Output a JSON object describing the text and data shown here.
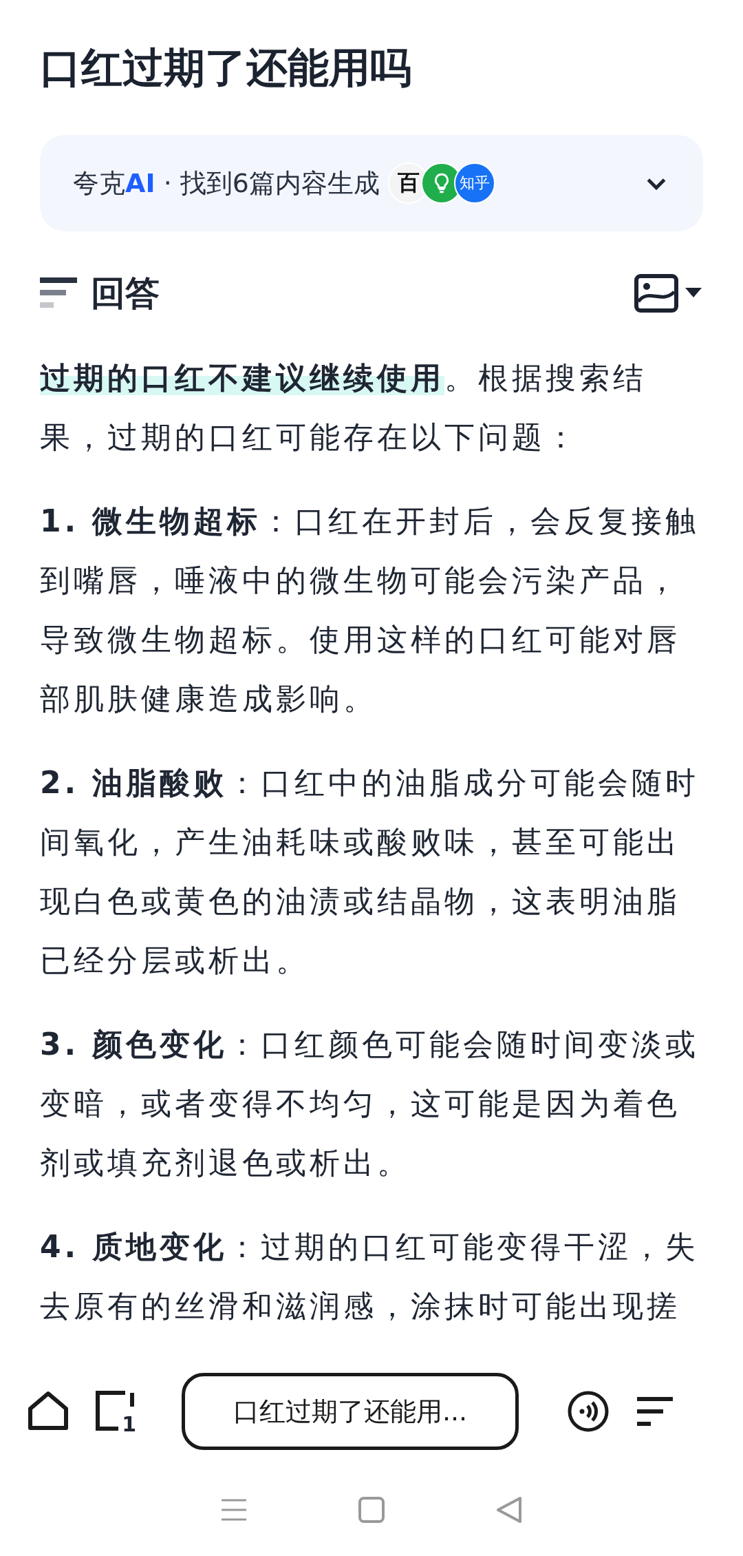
{
  "title": "口红过期了还能用吗",
  "source_card": {
    "brand": "夸克",
    "brand_ai": "AI",
    "summary": "· 找到6篇内容生成",
    "sources": [
      {
        "kind": "baike",
        "label": "百"
      },
      {
        "kind": "bulb"
      },
      {
        "kind": "zhihu",
        "label": "知乎"
      }
    ],
    "expanded": false
  },
  "answer": {
    "heading": "回答",
    "lead_highlight": "过期的口红不建议继续使用",
    "lead_rest": "。根据搜索结果，过期的口红可能存在以下问题：",
    "items": [
      {
        "number": "1.",
        "title": "微生物超标",
        "body": "：口红在开封后，会反复接触到嘴唇，唾液中的微生物可能会污染产品，导致微生物超标。使用这样的口红可能对唇部肌肤健康造成影响。"
      },
      {
        "number": "2.",
        "title": "油脂酸败",
        "body": "：口红中的油脂成分可能会随时间氧化，产生油耗味或酸败味，甚至可能出现白色或黄色的油渍或结晶物，这表明油脂已经分层或析出。"
      },
      {
        "number": "3.",
        "title": "颜色变化",
        "body": "：口红颜色可能会随时间变淡或变暗，或者变得不均匀，这可能是因为着色剂或填充剂退色或析出。"
      },
      {
        "number": "4.",
        "title": "质地变化",
        "body": "：过期的口红可能变得干涩，失去原有的丝滑和滋润感，涂抹时可能出现搓"
      }
    ]
  },
  "bottom_bar": {
    "tab_count": "1",
    "query": "口红过期了还能用..."
  }
}
